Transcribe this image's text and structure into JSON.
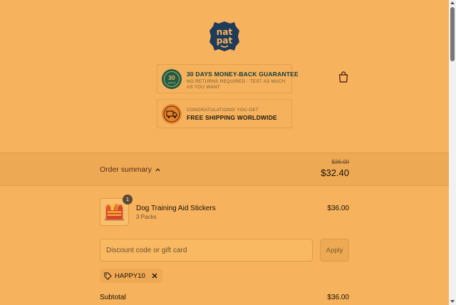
{
  "brand": {
    "logo_top": "nat",
    "logo_bottom": "pat"
  },
  "banners": {
    "guarantee": {
      "badge_num": "30",
      "badge_sub": "DAYS",
      "title": "30 DAYS MONEY-BACK GUARANTEE",
      "subtitle": "NO RETURNS REQUIRED - TEST AS MUCH AS YOU WANT"
    },
    "shipping": {
      "line1": "CONGRATULATIONS! YOU GET",
      "line2": "FREE SHIPPING WORLDWIDE"
    }
  },
  "order_summary": {
    "toggle_label": "Order summary",
    "original_total": "$36.00",
    "total": "$32.40"
  },
  "line_items": [
    {
      "quantity": "1",
      "name": "Dog Training Aid Stickers",
      "variant": "3 Packs",
      "price": "$36.00"
    }
  ],
  "discount": {
    "placeholder": "Discount code or gift card",
    "apply_label": "Apply",
    "applied_code": "HAPPY10"
  },
  "totals": {
    "subtotal_label": "Subtotal",
    "subtotal_value": "$36.00"
  },
  "colors": {
    "page_bg": "#f7b25d",
    "summary_bg": "#eea954",
    "logo": "#1f3b5a",
    "accent_text": "#5b2a1e"
  },
  "icons": [
    "natpat-logo",
    "shopping-bag-icon",
    "guarantee-badge-icon",
    "delivery-truck-icon",
    "chevron-up-icon",
    "tag-icon",
    "close-icon"
  ]
}
